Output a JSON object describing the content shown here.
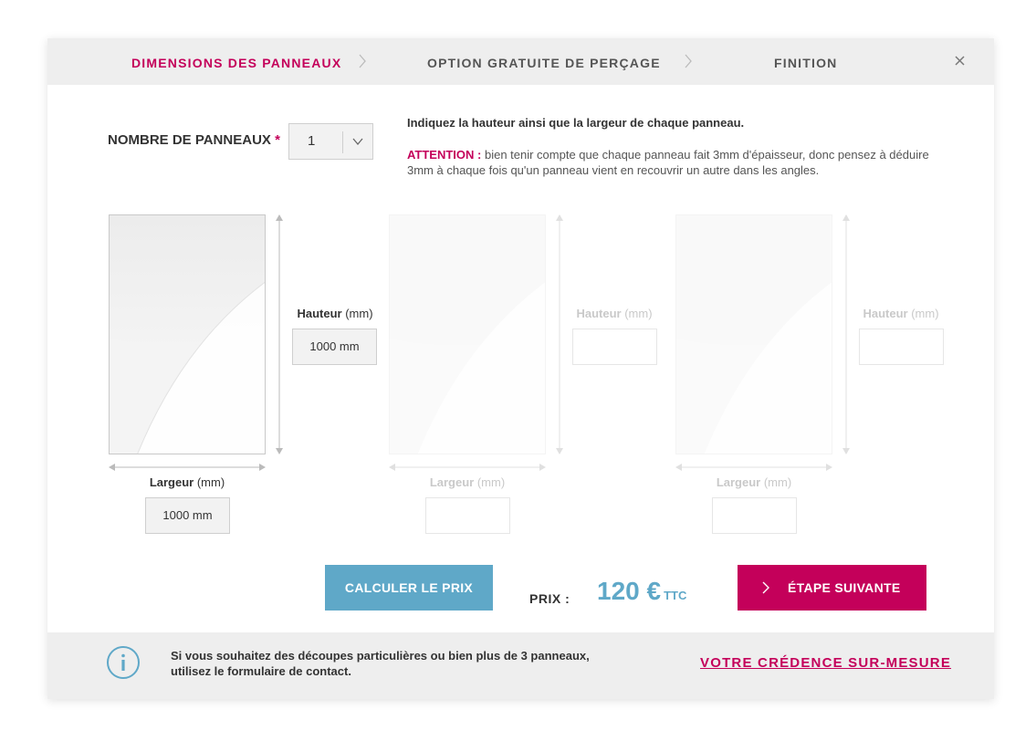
{
  "steps": [
    {
      "label": "DIMENSIONS DES PANNEAUX",
      "active": true
    },
    {
      "label": "OPTION GRATUITE DE PERÇAGE",
      "active": false
    },
    {
      "label": "FINITION",
      "active": false
    }
  ],
  "config": {
    "count_label": "NOMBRE DE PANNEAUX",
    "required_mark": "*",
    "count_value": "1"
  },
  "help": {
    "title": "Indiquez la hauteur ainsi que la largeur de chaque panneau.",
    "attention_label": "ATTENTION :",
    "attention_text": " bien tenir compte que chaque panneau fait 3mm d'épaisseur, donc pensez à déduire 3mm à chaque fois qu'un panneau vient en recouvrir un autre dans les angles."
  },
  "panels": [
    {
      "height_label": "Hauteur",
      "height_unit": "(mm)",
      "height_value": "1000 mm",
      "width_label": "Largeur",
      "width_unit": "(mm)",
      "width_value": "1000 mm",
      "enabled": true
    },
    {
      "height_label": "Hauteur",
      "height_unit": "(mm)",
      "height_value": "",
      "width_label": "Largeur",
      "width_unit": "(mm)",
      "width_value": "",
      "enabled": false
    },
    {
      "height_label": "Hauteur",
      "height_unit": "(mm)",
      "height_value": "",
      "width_label": "Largeur",
      "width_unit": "(mm)",
      "width_value": "",
      "enabled": false
    }
  ],
  "pricing": {
    "calc_label": "CALCULER LE PRIX",
    "price_label": "PRIX :",
    "price_value": "120 €",
    "price_suffix": "TTC",
    "next_label": "ÉTAPE SUIVANTE"
  },
  "footer": {
    "line1": "Si vous souhaitez des découpes particulières ou bien plus de 3 panneaux,",
    "line2": "utilisez le formulaire de contact.",
    "link_label": "VOTRE CRÉDENCE SUR-MESURE"
  },
  "colors": {
    "accent": "#c4005a",
    "blue": "#5fa8c8",
    "header_bg": "#eeeeee"
  },
  "icons": [
    "chevron-right-icon",
    "close-icon",
    "chevron-down-icon",
    "info-icon"
  ]
}
